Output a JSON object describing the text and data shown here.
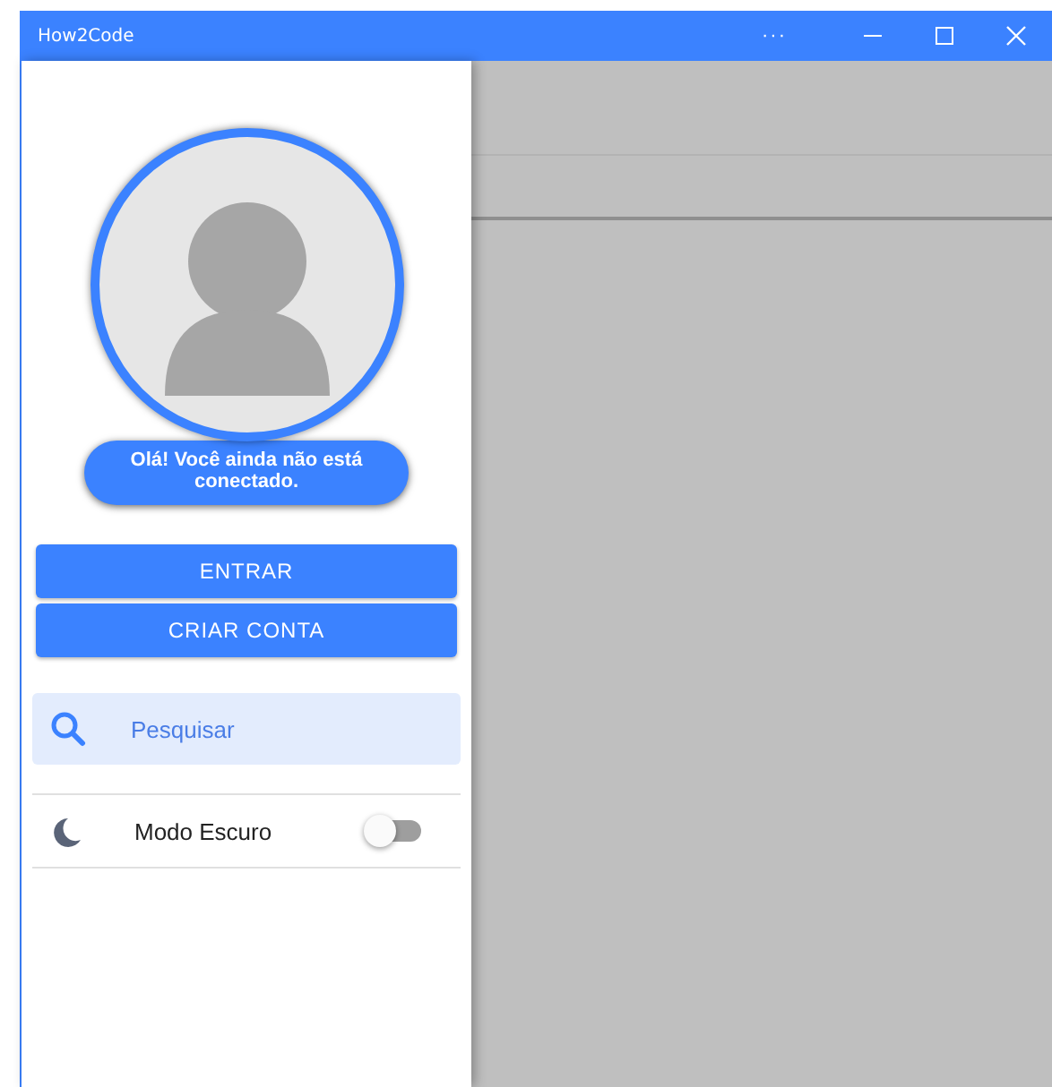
{
  "window": {
    "title": "How2Code",
    "controls": [
      "···"
    ]
  },
  "drawer": {
    "greeting": "Olá! Você ainda não está conectado.",
    "buttons": [
      "ENTRAR",
      "CRIAR CONTA"
    ],
    "menu": [
      {
        "label": "Pesquisar",
        "selected": true
      }
    ],
    "settings": [
      {
        "label": "Modo Escuro",
        "on": false
      }
    ]
  }
}
